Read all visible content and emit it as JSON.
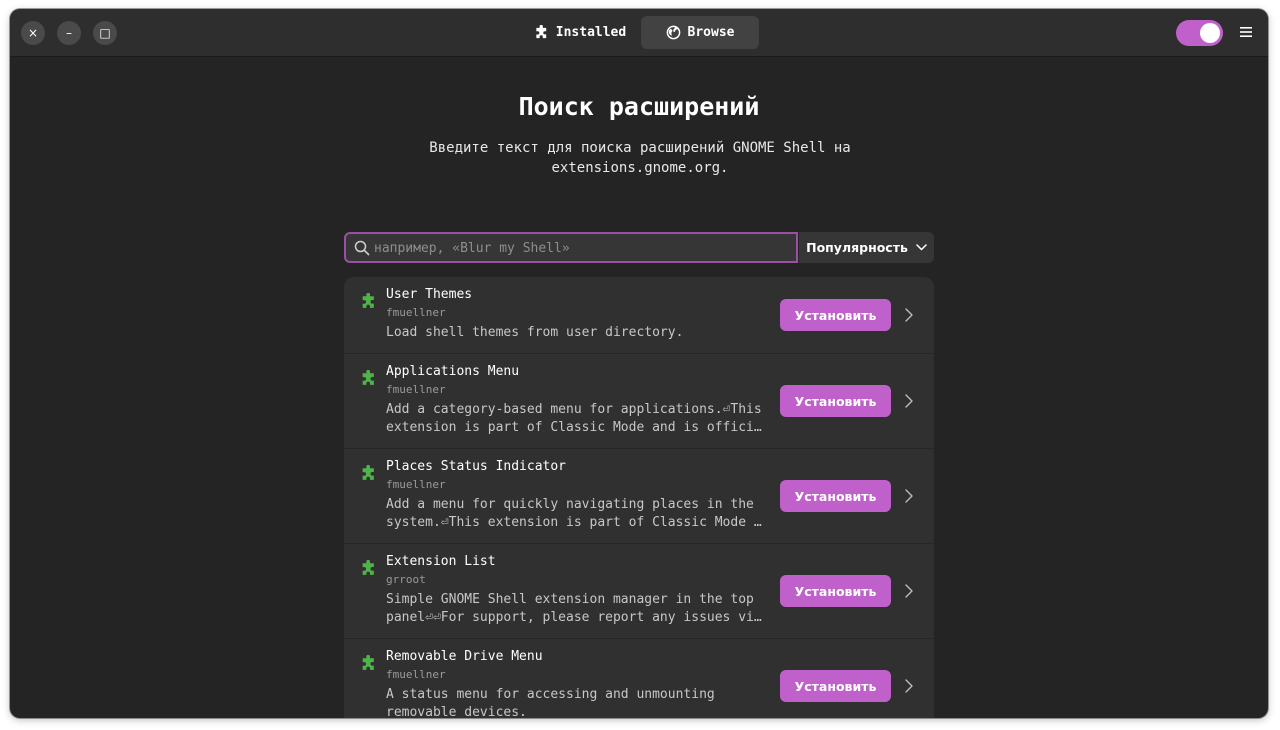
{
  "tabs": [
    {
      "label": "Installed",
      "icon": "puzzle-icon",
      "active": false
    },
    {
      "label": "Browse",
      "icon": "globe-icon",
      "active": true
    }
  ],
  "window_controls": {
    "close": "×",
    "minimize": "–",
    "maximize": "□"
  },
  "toggle": {
    "on": true
  },
  "page": {
    "title": "Поиск расширений",
    "subtitle_line1": "Введите текст для поиска расширений GNOME Shell на",
    "subtitle_line2": "extensions.gnome.org."
  },
  "search": {
    "placeholder": "например, «Blur my Shell»",
    "value": ""
  },
  "sort": {
    "label": "Популярность"
  },
  "extensions": [
    {
      "name": "User Themes",
      "author": "fmuellner",
      "description": "Load shell themes from user directory.",
      "install_label": "Установить"
    },
    {
      "name": "Applications Menu",
      "author": "fmuellner",
      "description": "Add a category-based menu for applications.⏎This\nextension is part of Classic Mode and is offici…",
      "install_label": "Установить"
    },
    {
      "name": "Places Status Indicator",
      "author": "fmuellner",
      "description": "Add a menu for quickly navigating places in the\nsystem.⏎This extension is part of Classic Mode …",
      "install_label": "Установить"
    },
    {
      "name": "Extension List",
      "author": "grroot",
      "description": "Simple GNOME Shell extension manager in the top\npanel⏎⏎For support, please report any issues vi…",
      "install_label": "Установить"
    },
    {
      "name": "Removable Drive Menu",
      "author": "fmuellner",
      "description": "A status menu for accessing and unmounting\nremovable devices.",
      "install_label": "Установить"
    }
  ],
  "colors": {
    "accent": "#c061cb",
    "window_bg": "#242424",
    "header_bg": "#2e2e2e",
    "list_bg": "#303030",
    "puzzle_green": "#4fb34a"
  }
}
